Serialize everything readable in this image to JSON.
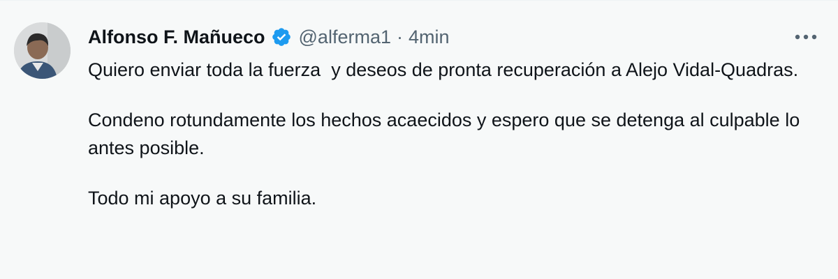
{
  "tweet": {
    "author": {
      "display_name": "Alfonso F. Mañueco",
      "handle": "@alferma1",
      "verified_icon": "verified-badge-icon",
      "avatar": "profile-photo"
    },
    "separator": "·",
    "time": "4min",
    "more_icon": "more-horizontal-icon",
    "paragraphs": [
      "Quiero enviar toda la fuerza  y deseos de pronta recuperación a Alejo Vidal-Quadras.",
      "Condeno rotundamente los hechos acaecidos y espero que se detenga al culpable lo antes posible.",
      "Todo mi apoyo a su familia."
    ]
  },
  "colors": {
    "background": "#f7f9f9",
    "text": "#0f1419",
    "secondary_text": "#536471",
    "verified_blue": "#1d9bf0"
  }
}
